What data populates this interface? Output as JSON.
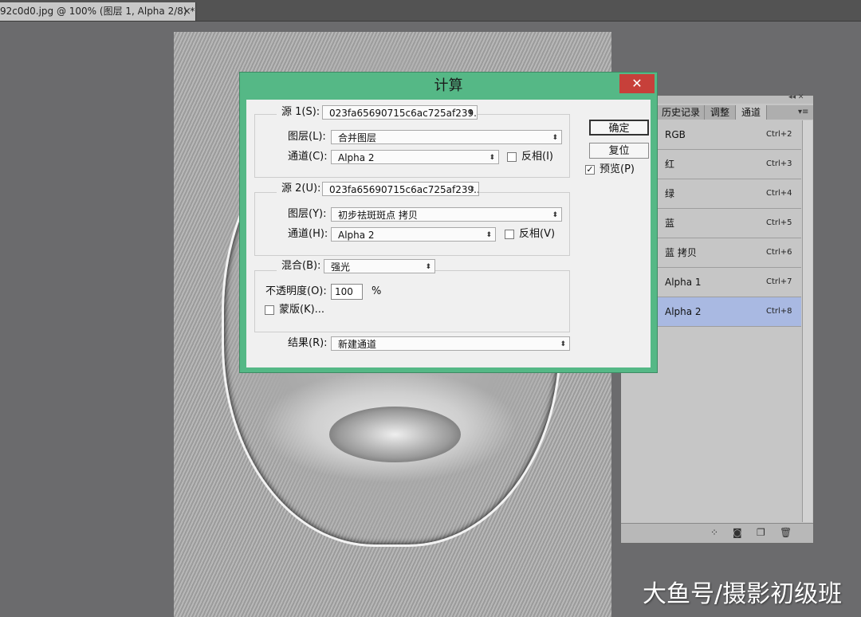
{
  "document": {
    "tab_title": "92c0d0.jpg @ 100% (图层 1, Alpha 2/8) *",
    "close_glyph": "×"
  },
  "dialog": {
    "title": "计算",
    "close_glyph": "✕",
    "source1": {
      "label": "源 1(S):",
      "file": "023fa65690715c6ac725af239...",
      "layer_label": "图层(L):",
      "layer": "合并图层",
      "channel_label": "通道(C):",
      "channel": "Alpha 2",
      "invert_label": "反相(I)",
      "invert_checked": false
    },
    "source2": {
      "label": "源 2(U):",
      "file": "023fa65690715c6ac725af239...",
      "layer_label": "图层(Y):",
      "layer": "初步祛斑斑点 拷贝",
      "channel_label": "通道(H):",
      "channel": "Alpha 2",
      "invert_label": "反相(V)",
      "invert_checked": false
    },
    "blend": {
      "label": "混合(B):",
      "mode": "强光",
      "opacity_label": "不透明度(O):",
      "opacity": "100",
      "opacity_unit": "%",
      "mask_label": "蒙版(K)...",
      "mask_checked": false
    },
    "result": {
      "label": "结果(R):",
      "value": "新建通道"
    },
    "ok_label": "确定",
    "reset_label": "复位",
    "preview_label": "预览(P)",
    "preview_checked": true
  },
  "channels_panel": {
    "tabs": [
      "历史记录",
      "调整",
      "通道"
    ],
    "active_tab": "通道",
    "channels": [
      {
        "name": "RGB",
        "shortcut": "Ctrl+2",
        "selected": false
      },
      {
        "name": "红",
        "shortcut": "Ctrl+3",
        "selected": false
      },
      {
        "name": "绿",
        "shortcut": "Ctrl+4",
        "selected": false
      },
      {
        "name": "蓝",
        "shortcut": "Ctrl+5",
        "selected": false
      },
      {
        "name": "蓝 拷贝",
        "shortcut": "Ctrl+6",
        "selected": false
      },
      {
        "name": "Alpha 1",
        "shortcut": "Ctrl+7",
        "selected": false
      },
      {
        "name": "Alpha 2",
        "shortcut": "Ctrl+8",
        "selected": true
      }
    ],
    "selected_color": "#a9b9e2"
  },
  "watermark": "大鱼号/摄影初级班",
  "colors": {
    "dialog_frame": "#55b886",
    "close_button": "#c7403a",
    "workspace": "#6b6b6d"
  }
}
